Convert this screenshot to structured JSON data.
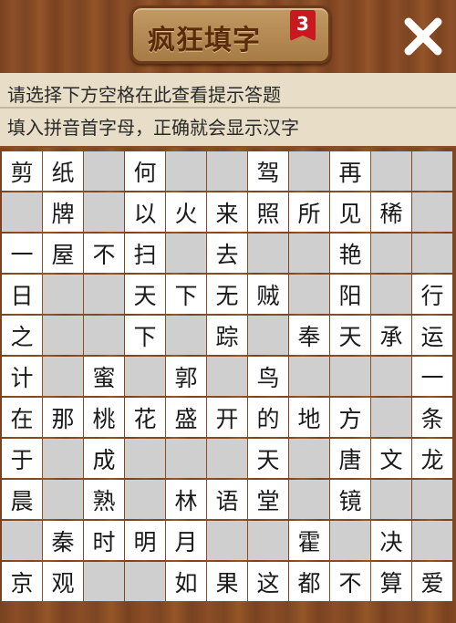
{
  "header": {
    "title": "疯狂填字",
    "level": "3",
    "close_icon": "close-icon"
  },
  "hints": {
    "line1": "请选择下方空格在此查看提示答题",
    "line2": "填入拼音首字母，正确就会显示汉字"
  },
  "grid": {
    "columns": 11,
    "rows": [
      [
        "剪",
        "纸",
        "",
        "何",
        "",
        "",
        "驾",
        "",
        "再",
        "",
        ""
      ],
      [
        "",
        "牌",
        "",
        "以",
        "火",
        "来",
        "照",
        "所",
        "见",
        "稀",
        ""
      ],
      [
        "一",
        "屋",
        "不",
        "扫",
        "",
        "去",
        "",
        "",
        "艳",
        "",
        ""
      ],
      [
        "日",
        "",
        "",
        "天",
        "下",
        "无",
        "贼",
        "",
        "阳",
        "",
        "行"
      ],
      [
        "之",
        "",
        "",
        "下",
        "",
        "踪",
        "",
        "奉",
        "天",
        "承",
        "运"
      ],
      [
        "计",
        "",
        "蜜",
        "",
        "郭",
        "",
        "鸟",
        "",
        "",
        "",
        "一"
      ],
      [
        "在",
        "那",
        "桃",
        "花",
        "盛",
        "开",
        "的",
        "地",
        "方",
        "",
        "条"
      ],
      [
        "于",
        "",
        "成",
        "",
        "",
        "",
        "天",
        "",
        "唐",
        "文",
        "龙"
      ],
      [
        "晨",
        "",
        "熟",
        "",
        "林",
        "语",
        "堂",
        "",
        "镜",
        "",
        ""
      ],
      [
        "",
        "秦",
        "时",
        "明",
        "月",
        "",
        "",
        "霍",
        "",
        "决",
        ""
      ],
      [
        "京",
        "观",
        "",
        "",
        "如",
        "果",
        "这",
        "都",
        "不",
        "算",
        "爱"
      ]
    ]
  },
  "colors": {
    "blank_cell": "#cfcfcf",
    "filled_cell": "#ffffff",
    "wood": "#8a4f26",
    "hint_bg": "#e8ddc6",
    "badge": "#c9181e"
  }
}
